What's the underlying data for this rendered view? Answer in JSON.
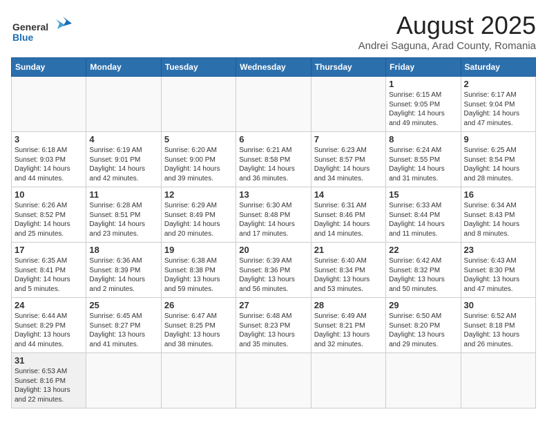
{
  "logo": {
    "text_general": "General",
    "text_blue": "Blue"
  },
  "title": "August 2025",
  "subtitle": "Andrei Saguna, Arad County, Romania",
  "days_of_week": [
    "Sunday",
    "Monday",
    "Tuesday",
    "Wednesday",
    "Thursday",
    "Friday",
    "Saturday"
  ],
  "weeks": [
    [
      {
        "day": "",
        "info": ""
      },
      {
        "day": "",
        "info": ""
      },
      {
        "day": "",
        "info": ""
      },
      {
        "day": "",
        "info": ""
      },
      {
        "day": "",
        "info": ""
      },
      {
        "day": "1",
        "info": "Sunrise: 6:15 AM\nSunset: 9:05 PM\nDaylight: 14 hours and 49 minutes."
      },
      {
        "day": "2",
        "info": "Sunrise: 6:17 AM\nSunset: 9:04 PM\nDaylight: 14 hours and 47 minutes."
      }
    ],
    [
      {
        "day": "3",
        "info": "Sunrise: 6:18 AM\nSunset: 9:03 PM\nDaylight: 14 hours and 44 minutes."
      },
      {
        "day": "4",
        "info": "Sunrise: 6:19 AM\nSunset: 9:01 PM\nDaylight: 14 hours and 42 minutes."
      },
      {
        "day": "5",
        "info": "Sunrise: 6:20 AM\nSunset: 9:00 PM\nDaylight: 14 hours and 39 minutes."
      },
      {
        "day": "6",
        "info": "Sunrise: 6:21 AM\nSunset: 8:58 PM\nDaylight: 14 hours and 36 minutes."
      },
      {
        "day": "7",
        "info": "Sunrise: 6:23 AM\nSunset: 8:57 PM\nDaylight: 14 hours and 34 minutes."
      },
      {
        "day": "8",
        "info": "Sunrise: 6:24 AM\nSunset: 8:55 PM\nDaylight: 14 hours and 31 minutes."
      },
      {
        "day": "9",
        "info": "Sunrise: 6:25 AM\nSunset: 8:54 PM\nDaylight: 14 hours and 28 minutes."
      }
    ],
    [
      {
        "day": "10",
        "info": "Sunrise: 6:26 AM\nSunset: 8:52 PM\nDaylight: 14 hours and 25 minutes."
      },
      {
        "day": "11",
        "info": "Sunrise: 6:28 AM\nSunset: 8:51 PM\nDaylight: 14 hours and 23 minutes."
      },
      {
        "day": "12",
        "info": "Sunrise: 6:29 AM\nSunset: 8:49 PM\nDaylight: 14 hours and 20 minutes."
      },
      {
        "day": "13",
        "info": "Sunrise: 6:30 AM\nSunset: 8:48 PM\nDaylight: 14 hours and 17 minutes."
      },
      {
        "day": "14",
        "info": "Sunrise: 6:31 AM\nSunset: 8:46 PM\nDaylight: 14 hours and 14 minutes."
      },
      {
        "day": "15",
        "info": "Sunrise: 6:33 AM\nSunset: 8:44 PM\nDaylight: 14 hours and 11 minutes."
      },
      {
        "day": "16",
        "info": "Sunrise: 6:34 AM\nSunset: 8:43 PM\nDaylight: 14 hours and 8 minutes."
      }
    ],
    [
      {
        "day": "17",
        "info": "Sunrise: 6:35 AM\nSunset: 8:41 PM\nDaylight: 14 hours and 5 minutes."
      },
      {
        "day": "18",
        "info": "Sunrise: 6:36 AM\nSunset: 8:39 PM\nDaylight: 14 hours and 2 minutes."
      },
      {
        "day": "19",
        "info": "Sunrise: 6:38 AM\nSunset: 8:38 PM\nDaylight: 13 hours and 59 minutes."
      },
      {
        "day": "20",
        "info": "Sunrise: 6:39 AM\nSunset: 8:36 PM\nDaylight: 13 hours and 56 minutes."
      },
      {
        "day": "21",
        "info": "Sunrise: 6:40 AM\nSunset: 8:34 PM\nDaylight: 13 hours and 53 minutes."
      },
      {
        "day": "22",
        "info": "Sunrise: 6:42 AM\nSunset: 8:32 PM\nDaylight: 13 hours and 50 minutes."
      },
      {
        "day": "23",
        "info": "Sunrise: 6:43 AM\nSunset: 8:30 PM\nDaylight: 13 hours and 47 minutes."
      }
    ],
    [
      {
        "day": "24",
        "info": "Sunrise: 6:44 AM\nSunset: 8:29 PM\nDaylight: 13 hours and 44 minutes."
      },
      {
        "day": "25",
        "info": "Sunrise: 6:45 AM\nSunset: 8:27 PM\nDaylight: 13 hours and 41 minutes."
      },
      {
        "day": "26",
        "info": "Sunrise: 6:47 AM\nSunset: 8:25 PM\nDaylight: 13 hours and 38 minutes."
      },
      {
        "day": "27",
        "info": "Sunrise: 6:48 AM\nSunset: 8:23 PM\nDaylight: 13 hours and 35 minutes."
      },
      {
        "day": "28",
        "info": "Sunrise: 6:49 AM\nSunset: 8:21 PM\nDaylight: 13 hours and 32 minutes."
      },
      {
        "day": "29",
        "info": "Sunrise: 6:50 AM\nSunset: 8:20 PM\nDaylight: 13 hours and 29 minutes."
      },
      {
        "day": "30",
        "info": "Sunrise: 6:52 AM\nSunset: 8:18 PM\nDaylight: 13 hours and 26 minutes."
      }
    ],
    [
      {
        "day": "31",
        "info": "Sunrise: 6:53 AM\nSunset: 8:16 PM\nDaylight: 13 hours and 22 minutes."
      },
      {
        "day": "",
        "info": ""
      },
      {
        "day": "",
        "info": ""
      },
      {
        "day": "",
        "info": ""
      },
      {
        "day": "",
        "info": ""
      },
      {
        "day": "",
        "info": ""
      },
      {
        "day": "",
        "info": ""
      }
    ]
  ]
}
